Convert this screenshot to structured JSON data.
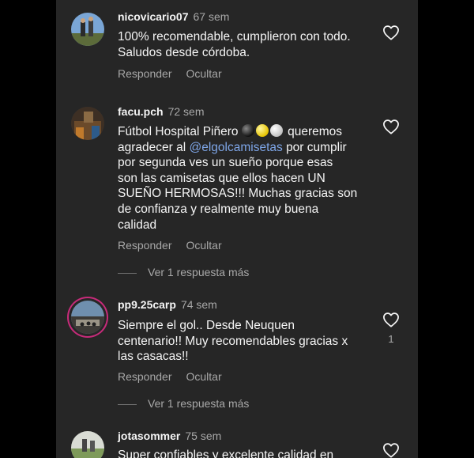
{
  "comments": [
    {
      "username": "nicovicario07",
      "time": "67 sem",
      "lines": [
        "100% recomendable, cumplieron con todo.",
        "Saludos desde córdoba."
      ],
      "reply_label": "Responder",
      "hide_label": "Ocultar"
    },
    {
      "username": "facu.pch",
      "time": "72 sem",
      "line1": "Fútbol Hospital Piñero",
      "line1_after": "queremos",
      "line2_before": "agradecer al",
      "mention": "@elgolcamisetas",
      "line2_after": "por cumplir",
      "lines_rest": [
        "por segunda ves un sueño porque esas",
        "son las camisetas que ellos hacen UN",
        "SUEÑO HERMOSAS!!! Muchas gracias son",
        "de confianza y realmente muy buena",
        "calidad"
      ],
      "reply_label": "Responder",
      "hide_label": "Ocultar",
      "view_replies": "Ver 1 respuesta más"
    },
    {
      "username": "pp9.25carp",
      "time": "74 sem",
      "lines": [
        "Siempre el gol.. Desde Neuquen",
        "centenario!! Muy recomendables gracias x",
        "las casacas!!"
      ],
      "likes": "1",
      "reply_label": "Responder",
      "hide_label": "Ocultar",
      "view_replies": "Ver 1 respuesta más"
    },
    {
      "username": "jotasommer",
      "time": "75 sem",
      "lines": [
        "Super confiables y excelente calidad en"
      ]
    }
  ],
  "icons": {
    "like": "heart-outline-icon"
  },
  "colors": {
    "panel": "#262626",
    "secondary_text": "#a8a8a8",
    "mention": "#7ea6e8",
    "story_ring": "#c72b7a"
  }
}
